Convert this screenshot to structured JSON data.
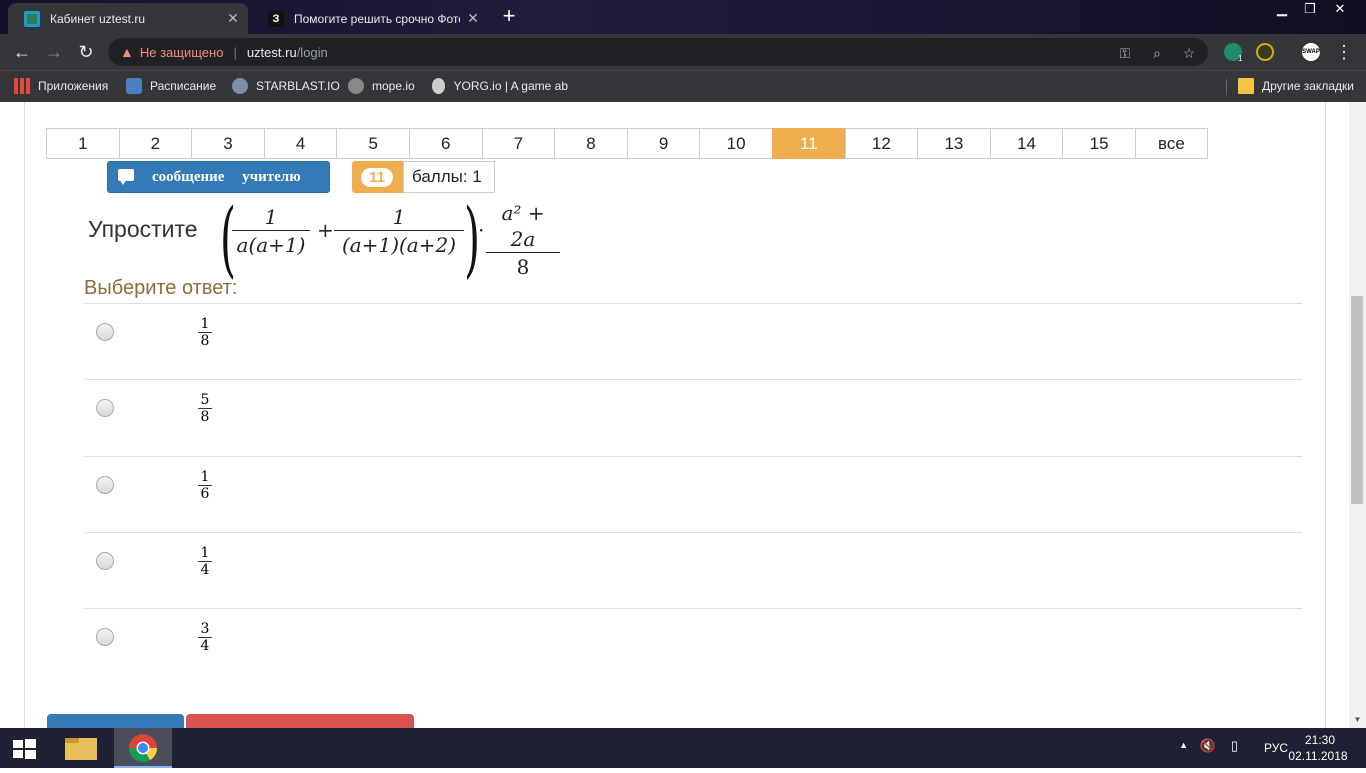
{
  "browser": {
    "tabs": [
      {
        "title": "Кабинет uztest.ru",
        "favicon": "uztest-icon",
        "active": true
      },
      {
        "title": "Помогите решить срочно Фото",
        "favicon": "znanija-icon",
        "active": false
      }
    ],
    "address": {
      "security_label": "Не защищено",
      "host": "uztest.ru",
      "path": "/login"
    },
    "bookmarks": [
      {
        "label": "Приложения",
        "icon": "apps-grid-icon"
      },
      {
        "label": "Расписание",
        "icon": "chat-icon"
      },
      {
        "label": "STARBLAST.IO",
        "icon": "ship-icon"
      },
      {
        "label": "mope.io",
        "icon": "mope-icon"
      },
      {
        "label": "YORG.io | A game ab",
        "icon": "yorg-icon"
      }
    ],
    "other_bookmarks": "Другие закладки",
    "extension_badge": "1",
    "swap_label": "SWAP"
  },
  "pager": {
    "pages": [
      "1",
      "2",
      "3",
      "4",
      "5",
      "6",
      "7",
      "8",
      "9",
      "10",
      "11",
      "12",
      "13",
      "14",
      "15",
      "все"
    ],
    "active": "11",
    "active_color": "#f0ad4e"
  },
  "message_button": "сообщение учителю",
  "question_number": "11",
  "score_label": "баллы: 1",
  "question": {
    "prompt": "Упростите",
    "term1_num": "1",
    "term1_den": "a(a+1)",
    "plus": "+",
    "term2_num": "1",
    "term2_den": "(a+1)(a+2)",
    "dot": "·",
    "mult_num": "a² + 2a",
    "mult_den": "8"
  },
  "choose_label": "Выберите ответ:",
  "options": [
    {
      "num": "1",
      "den": "8"
    },
    {
      "num": "5",
      "den": "8"
    },
    {
      "num": "1",
      "den": "6"
    },
    {
      "num": "1",
      "den": "4"
    },
    {
      "num": "3",
      "den": "4"
    }
  ],
  "taskbar": {
    "lang": "РУС",
    "time": "21:30",
    "date": "02.11.2018"
  }
}
